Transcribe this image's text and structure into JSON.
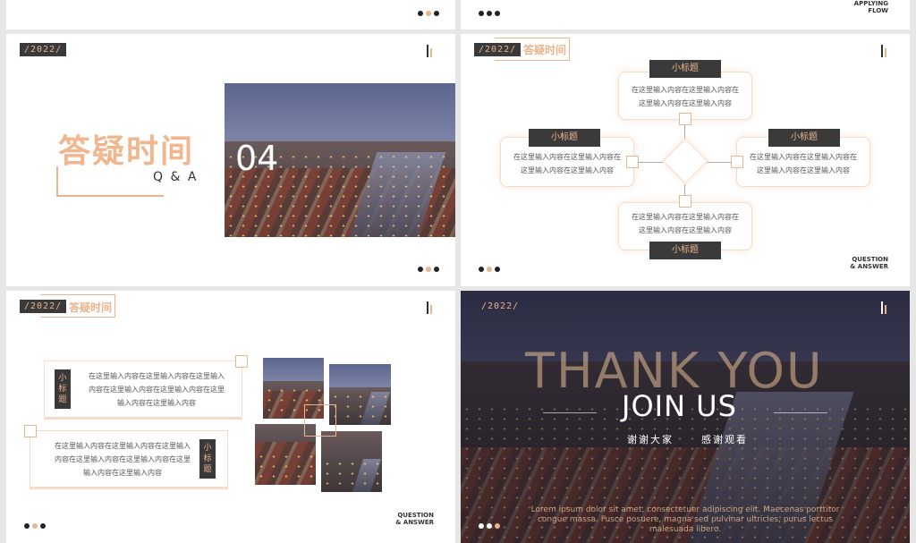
{
  "top_left_slide": {
    "dots": [
      "dark",
      "accent",
      "dark"
    ]
  },
  "top_right_slide": {
    "corner_text": "APPLYING\nFLOW",
    "dots": [
      "dark",
      "dark",
      "dark"
    ]
  },
  "slide_qa": {
    "year": "/2022/",
    "title": "答疑时间",
    "subtitle": "Q & A",
    "number": "04",
    "dots": [
      "dark",
      "accent",
      "dark"
    ]
  },
  "slide_diagram": {
    "year": "/2022/",
    "title": "答疑时间",
    "label": "小标题",
    "text_line1": "在这里输入内容在这里输入内容在",
    "text_line2": "这里输入内容在这里输入内容",
    "corner_text": "QUESTION\n& ANSWER",
    "dots": [
      "dark",
      "accent",
      "dark"
    ]
  },
  "slide_photos": {
    "year": "/2022/",
    "title": "答疑时间",
    "label_chars": [
      "小",
      "标",
      "题"
    ],
    "para_line1": "在这里输入内容在这里输入内容在这里输入",
    "para_line2": "内容在这里输入内容在这里输入内容在这里",
    "para_line3": "输入内容在这里输入内容",
    "corner_text": "QUESTION\n& ANSWER",
    "dots": [
      "dark",
      "accent",
      "dark"
    ]
  },
  "slide_thanks": {
    "year": "/2022/",
    "big_text": "THANK YOU",
    "headline": "JOIN US",
    "subline_left": "谢谢大家",
    "subline_right": "感谢观看",
    "lorem_1": "Lorem ipsum dolor sit amet, consectetuer adipiscing elit. Maecenas porttitor",
    "lorem_2": "congue massa. Fusce posuere, magna sed pulvinar ultricies, purus lectus",
    "lorem_3": "malesuada libero.",
    "dots": [
      "light",
      "light",
      "accent"
    ]
  },
  "colors": {
    "accent": "#e8b48d",
    "dark": "#3a3a3a"
  }
}
